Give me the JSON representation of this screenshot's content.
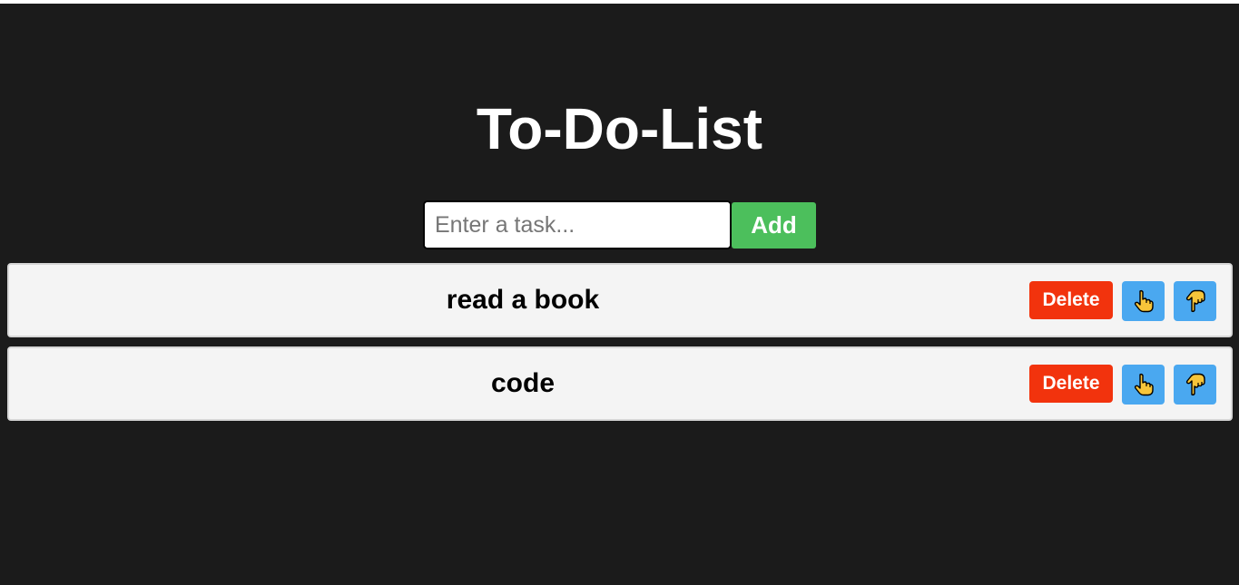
{
  "title": "To-Do-List",
  "form": {
    "placeholder": "Enter a task...",
    "value": "",
    "add_label": "Add"
  },
  "tasks": [
    {
      "text": "read a book",
      "delete_label": "Delete",
      "up_icon": "pointing-up-hand-icon",
      "down_icon": "pointing-down-hand-icon"
    },
    {
      "text": "code",
      "delete_label": "Delete",
      "up_icon": "pointing-up-hand-icon",
      "down_icon": "pointing-down-hand-icon"
    }
  ],
  "colors": {
    "background": "#1b1b1b",
    "add_button": "#4cbf5c",
    "delete_button": "#f2330d",
    "move_button": "#4aa8f0",
    "task_background": "#f4f4f4",
    "hand_icon": "#f7c53a"
  }
}
